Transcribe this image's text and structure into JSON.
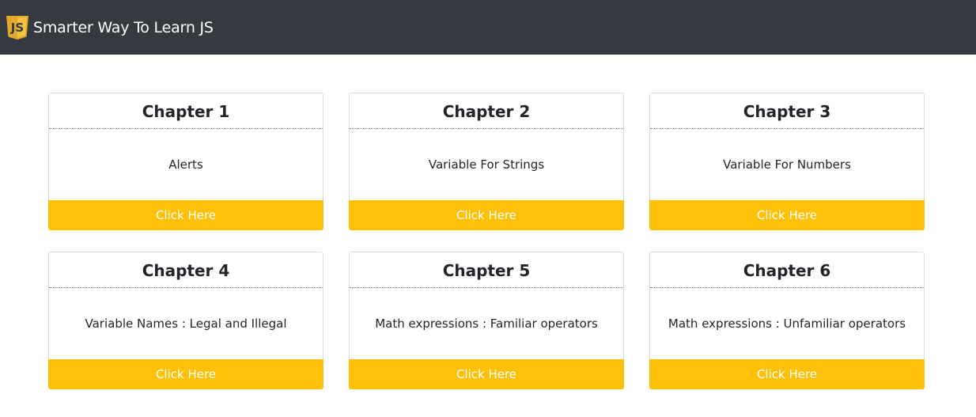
{
  "navbar": {
    "brand_text": "Smarter Way To Learn JS",
    "logo_icon": "js-shield-icon",
    "logo_text": "JS",
    "bg_color": "#343a40"
  },
  "chapters": [
    {
      "title": "Chapter 1",
      "description": "Alerts",
      "button_label": "Click Here"
    },
    {
      "title": "Chapter 2",
      "description": "Variable For Strings",
      "button_label": "Click Here"
    },
    {
      "title": "Chapter 3",
      "description": "Variable For Numbers",
      "button_label": "Click Here"
    },
    {
      "title": "Chapter 4",
      "description": "Variable Names : Legal and Illegal",
      "button_label": "Click Here"
    },
    {
      "title": "Chapter 5",
      "description": "Math expressions : Familiar operators",
      "button_label": "Click Here"
    },
    {
      "title": "Chapter 6",
      "description": "Math expressions : Unfamiliar operators",
      "button_label": "Click Here"
    }
  ],
  "colors": {
    "accent": "#ffc107",
    "card_border": "#dcdcdc"
  }
}
